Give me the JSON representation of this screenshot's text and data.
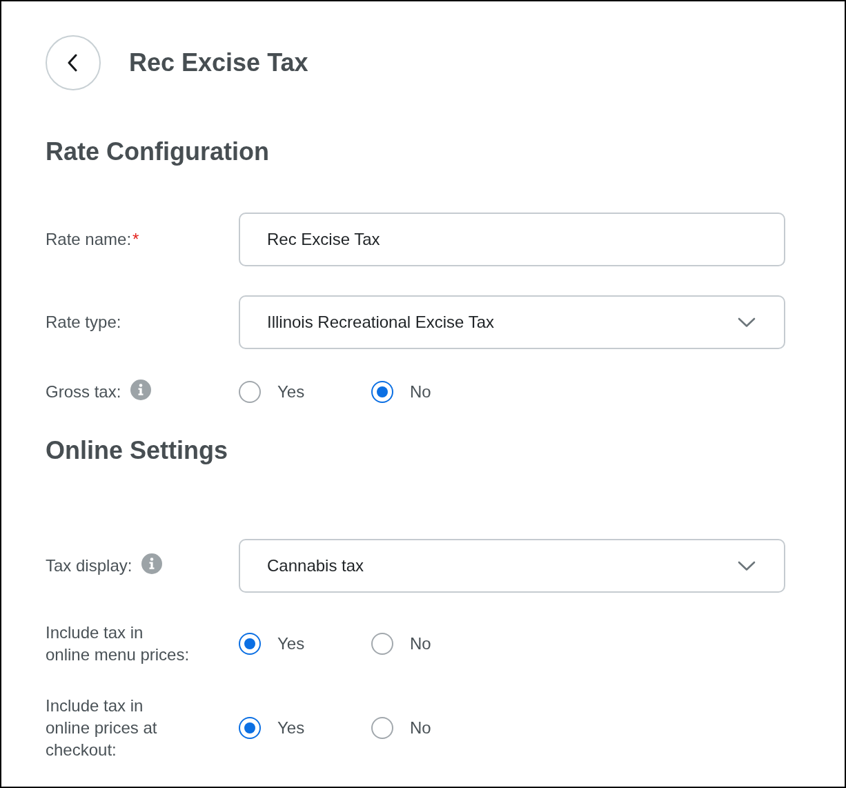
{
  "header": {
    "title": "Rec Excise Tax"
  },
  "sections": [
    {
      "heading": "Rate Configuration",
      "rows": [
        {
          "kind": "text",
          "label": "Rate name:",
          "required_mark": "*",
          "value": "Rec Excise Tax"
        },
        {
          "kind": "select",
          "label": "Rate type:",
          "value": "Illinois Recreational Excise Tax"
        },
        {
          "kind": "radio",
          "label": "Gross tax:",
          "info": true,
          "options": [
            {
              "label": "Yes",
              "selected": false
            },
            {
              "label": "No",
              "selected": true
            }
          ]
        }
      ]
    },
    {
      "heading": "Online Settings",
      "rows": [
        {
          "kind": "select",
          "label": "Tax display:",
          "info": true,
          "value": "Cannabis tax"
        },
        {
          "kind": "radio",
          "label": "Include tax in\nonline menu prices:",
          "options": [
            {
              "label": "Yes",
              "selected": true
            },
            {
              "label": "No",
              "selected": false
            }
          ]
        },
        {
          "kind": "radio",
          "label": "Include tax in\nonline prices at\ncheckout:",
          "options": [
            {
              "label": "Yes",
              "selected": true
            },
            {
              "label": "No",
              "selected": false
            }
          ]
        }
      ]
    }
  ]
}
